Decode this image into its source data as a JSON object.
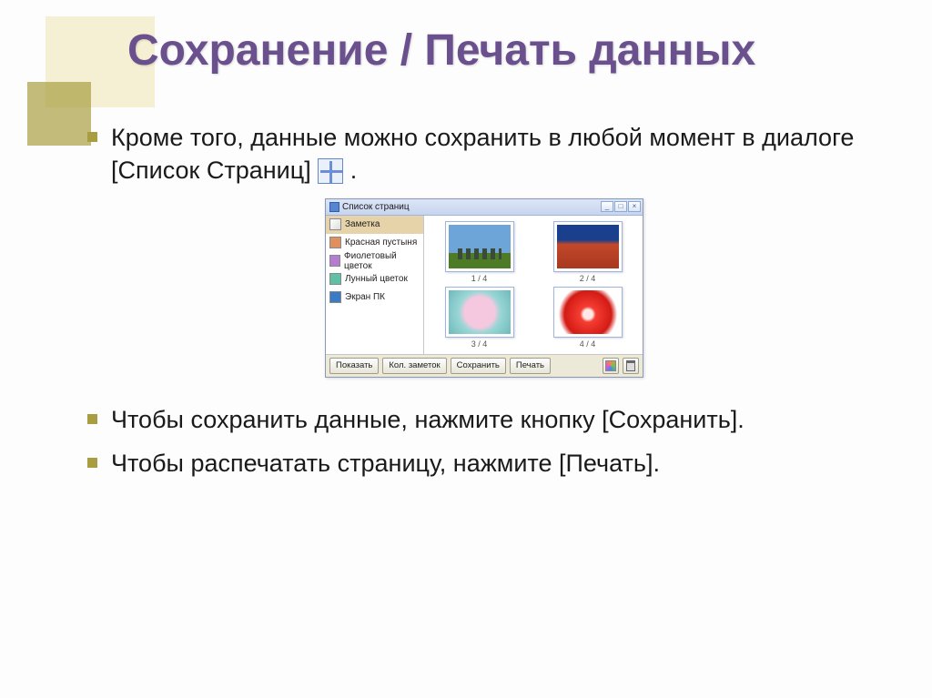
{
  "slide": {
    "title": "Сохранение / Печать данных",
    "bullets": [
      "Кроме того, данные можно сохранить в любой момент в диалоге [Список Страниц] ",
      "Чтобы сохранить данные, нажмите кнопку [Сохранить].",
      "Чтобы распечатать страницу, нажмите [Печать]."
    ]
  },
  "dialog": {
    "title": "Список страниц",
    "win_buttons": {
      "min": "_",
      "max": "□",
      "close": "×"
    },
    "sidebar": [
      {
        "label": "Заметка",
        "icon": "note",
        "selected": true
      },
      {
        "label": "Красная пустыня",
        "icon": "desert",
        "selected": false
      },
      {
        "label": "Фиолетовый цветок",
        "icon": "flower",
        "selected": false
      },
      {
        "label": "Лунный цветок",
        "icon": "moon",
        "selected": false
      },
      {
        "label": "Экран ПК",
        "icon": "screen",
        "selected": false
      }
    ],
    "thumbs": [
      {
        "label": "1 / 4",
        "img": "stonehenge"
      },
      {
        "label": "2 / 4",
        "img": "desert"
      },
      {
        "label": "3 / 4",
        "img": "pinkflower"
      },
      {
        "label": "4 / 4",
        "img": "redflower"
      }
    ],
    "buttons": {
      "show": "Показать",
      "rename": "Кол. заметок",
      "save": "Сохранить",
      "print": "Печать"
    }
  }
}
